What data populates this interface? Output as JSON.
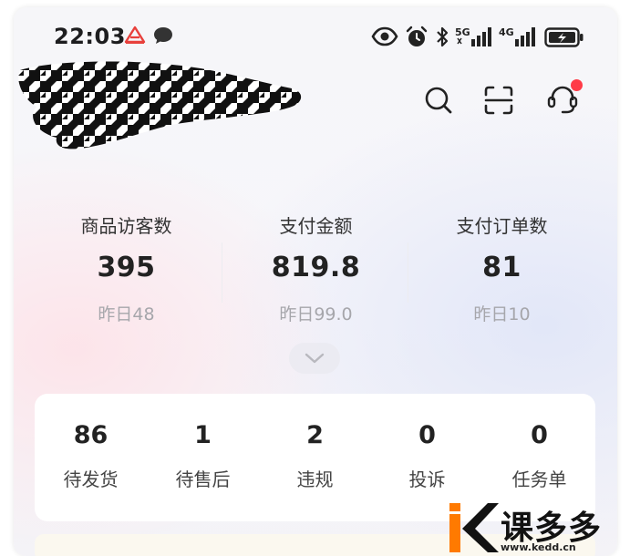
{
  "status_bar": {
    "time": "22:03",
    "net_1": "5G",
    "net_2": "4G",
    "icons": [
      "app-notification-icon",
      "chat-bubble-icon",
      "eye-icon",
      "alarm-icon",
      "bluetooth-icon",
      "signal-icon",
      "battery-charging-icon"
    ]
  },
  "header": {
    "actions": [
      "search-icon",
      "scan-icon",
      "customer-service-icon"
    ],
    "has_notification": true
  },
  "stats": [
    {
      "label": "商品访客数",
      "value": "395",
      "prev_prefix": "昨日",
      "prev_value": "48"
    },
    {
      "label": "支付金额",
      "value": "819.8",
      "prev_prefix": "昨日",
      "prev_value": "99.0"
    },
    {
      "label": "支付订单数",
      "value": "81",
      "prev_prefix": "昨日",
      "prev_value": "10"
    }
  ],
  "orders": [
    {
      "count": "86",
      "label": "待发货"
    },
    {
      "count": "1",
      "label": "待售后"
    },
    {
      "count": "2",
      "label": "违规"
    },
    {
      "count": "0",
      "label": "投诉"
    },
    {
      "count": "0",
      "label": "任务单"
    }
  ],
  "watermark": {
    "title": "课多多",
    "url": "www.kedd.cn"
  },
  "colors": {
    "accent": "#ff3b47",
    "text_primary": "#222222",
    "text_muted": "#a6a6ab",
    "brand_watermark": "#ff7a00"
  }
}
